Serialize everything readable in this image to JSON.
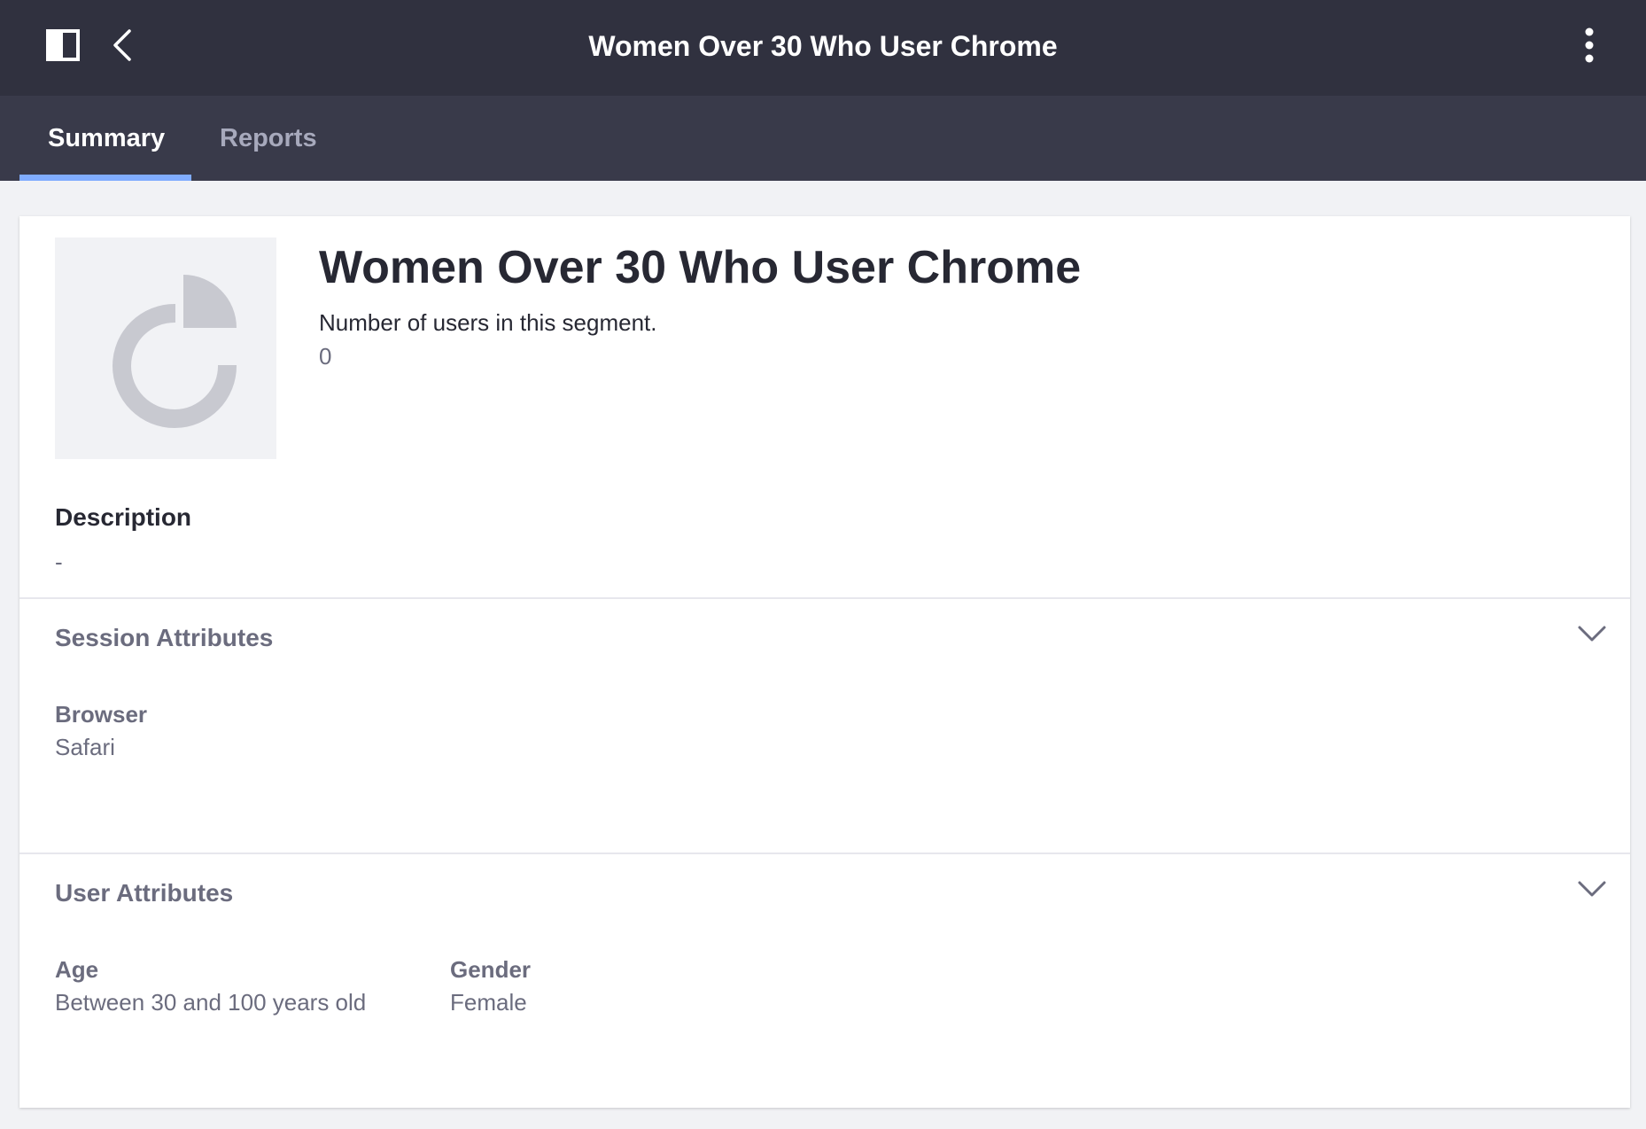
{
  "header": {
    "title": "Women Over 30 Who User Chrome",
    "icons": {
      "panel": "sidebar-toggle-icon",
      "back": "chevron-left-icon",
      "menu": "kebab-menu-icon"
    }
  },
  "tabs": [
    {
      "label": "Summary",
      "active": true
    },
    {
      "label": "Reports",
      "active": false
    }
  ],
  "segment": {
    "image_icon": "pie-chart-icon",
    "title": "Women Over 30 Who User Chrome",
    "count_label": "Number of users in this segment.",
    "count_value": "0",
    "description_heading": "Description",
    "description_value": "-"
  },
  "sections": {
    "session": {
      "title": "Session Attributes",
      "attributes": [
        {
          "label": "Browser",
          "value": "Safari"
        }
      ]
    },
    "user": {
      "title": "User Attributes",
      "attributes": [
        {
          "label": "Age",
          "value": "Between 30 and 100 years old"
        },
        {
          "label": "Gender",
          "value": "Female"
        }
      ]
    }
  },
  "colors": {
    "header_bg": "#30313f",
    "tabbar_bg": "#393a4a",
    "tab_indicator": "#80acff",
    "page_bg": "#f1f2f5",
    "icon_gray": "#c8c9d0"
  }
}
